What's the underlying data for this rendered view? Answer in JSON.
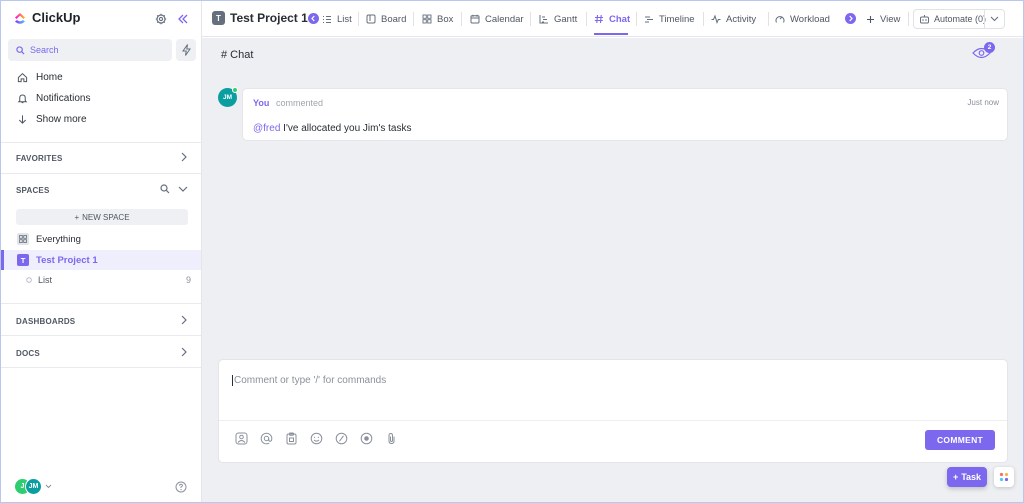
{
  "app": {
    "name": "ClickUp"
  },
  "sidebar": {
    "search_placeholder": "Search",
    "nav": [
      {
        "label": "Home",
        "icon": "home-icon"
      },
      {
        "label": "Notifications",
        "icon": "bell-icon"
      },
      {
        "label": "Show more",
        "icon": "arrow-down-icon"
      }
    ],
    "favorites_label": "FAVORITES",
    "spaces_label": "SPACES",
    "new_space_label": "NEW SPACE",
    "spaces": [
      {
        "label": "Everything"
      },
      {
        "label": "Test Project 1",
        "badge": "T"
      }
    ],
    "list": {
      "label": "List",
      "count": "9"
    },
    "dashboards_label": "DASHBOARDS",
    "docs_label": "DOCS",
    "avatars": [
      "J",
      "JM"
    ]
  },
  "topbar": {
    "project_badge": "T",
    "project_title": "Test Project 1",
    "tabs": [
      "List",
      "Board",
      "Box",
      "Calendar",
      "Gantt",
      "Chat",
      "Timeline",
      "Activity",
      "Workload"
    ],
    "active_tab": "Chat",
    "add_view_label": "View",
    "automate_label": "Automate (0)"
  },
  "chat": {
    "title": "# Chat",
    "watchers_count": "2",
    "message": {
      "avatar": "JM",
      "author": "You",
      "action": "commented",
      "time": "Just now",
      "mention": "@fred",
      "text": " I've allocated you Jim's tasks"
    },
    "comment_placeholder": "Comment or type '/' for commands",
    "comment_button": "COMMENT"
  },
  "fab": {
    "task_label": "Task"
  },
  "colors": {
    "accent": "#7b68ee",
    "avatar_teal": "#0b9ea0",
    "avatar_green": "#2ecd6f"
  }
}
